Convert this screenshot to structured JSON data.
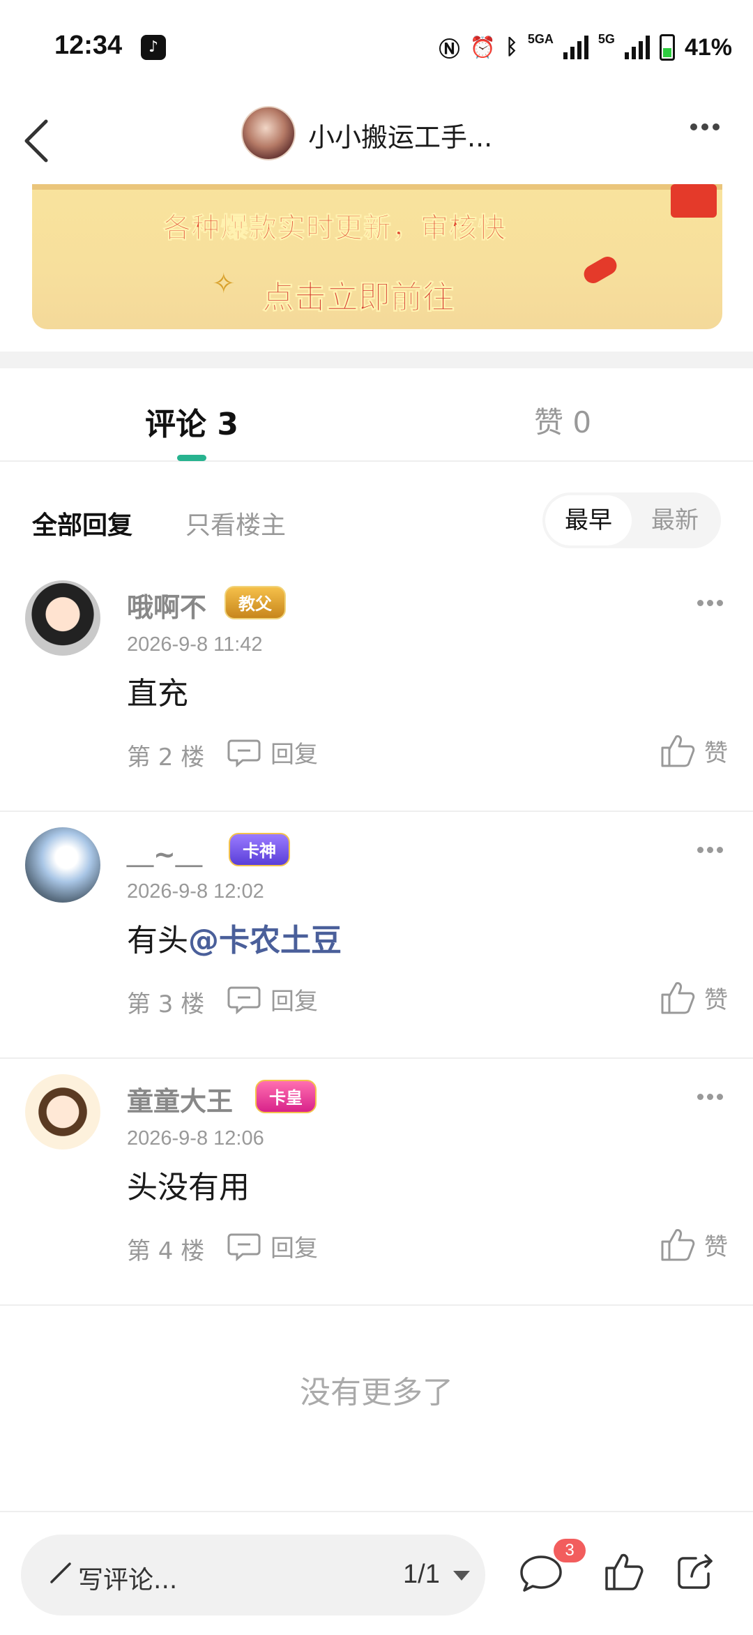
{
  "status_bar": {
    "time": "12:34",
    "network_label_1": "5GA",
    "network_label_2": "5G",
    "battery": "41%"
  },
  "header": {
    "title": "小小搬运工手..."
  },
  "banner": {
    "line1": "各种爆款实时更新，审核快",
    "line2": "点击立即前往"
  },
  "tabs": {
    "comments": "评论 3",
    "likes": "赞 0"
  },
  "filters": {
    "all": "全部回复",
    "op_only": "只看楼主",
    "sort_earliest": "最早",
    "sort_latest": "最新"
  },
  "comments": [
    {
      "name": "哦啊不",
      "badge": "教父",
      "time": "2026-9-8 11:42",
      "text": "直充",
      "mention": "",
      "floor": "第 2 楼",
      "reply_label": "回复",
      "like_label": "赞"
    },
    {
      "name": "＿~＿",
      "badge": "卡神",
      "time": "2026-9-8 12:02",
      "text": "有头",
      "mention": "@卡农土豆",
      "floor": "第 3 楼",
      "reply_label": "回复",
      "like_label": "赞"
    },
    {
      "name": "童童大王",
      "badge": "卡皇",
      "time": "2026-9-8 12:06",
      "text": "头没有用",
      "mention": "",
      "floor": "第 4 楼",
      "reply_label": "回复",
      "like_label": "赞"
    }
  ],
  "footer_note": "没有更多了",
  "bottom_bar": {
    "write_placeholder": "写评论...",
    "page_indicator": "1/1",
    "comment_count_badge": "3"
  },
  "colors": {
    "accent": "#27b38f",
    "mention": "#4a5f9a",
    "badge_red": "#f25d5d"
  }
}
